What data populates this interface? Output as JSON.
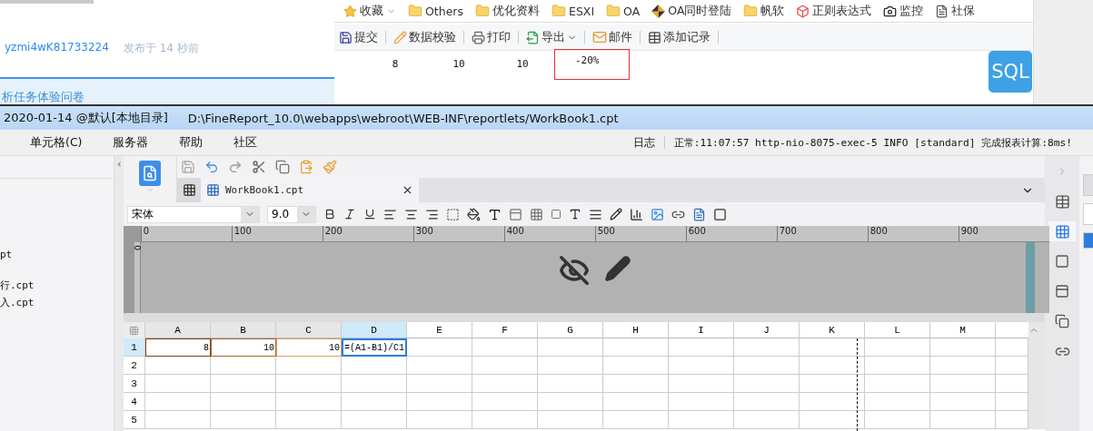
{
  "web_page": {
    "author": "yzmi4wK81733224",
    "posted": "发布于 14 秒前",
    "banner": "析任务体验问卷"
  },
  "browser": {
    "bookmarks": [
      {
        "label": "收藏",
        "kind": "star"
      },
      {
        "label": "Others",
        "kind": "folder"
      },
      {
        "label": "优化资料",
        "kind": "folder"
      },
      {
        "label": "ESXI",
        "kind": "folder"
      },
      {
        "label": "OA",
        "kind": "folder"
      },
      {
        "label": "OA同时登陆",
        "kind": "pinwheel"
      },
      {
        "label": "帆软",
        "kind": "folder"
      },
      {
        "label": "正则表达式",
        "kind": "cube"
      },
      {
        "label": "监控",
        "kind": "camera"
      },
      {
        "label": "社保",
        "kind": "document"
      }
    ],
    "toolbar": [
      {
        "label": "提交",
        "kind": "save"
      },
      {
        "label": "数据校验",
        "kind": "check"
      },
      {
        "label": "打印",
        "kind": "print"
      },
      {
        "label": "导出",
        "kind": "export"
      },
      {
        "label": "邮件",
        "kind": "mail"
      },
      {
        "label": "添加记录",
        "kind": "add"
      }
    ],
    "report_row": [
      {
        "value": "8",
        "highlighted": false
      },
      {
        "value": "10",
        "highlighted": false
      },
      {
        "value": "10",
        "highlighted": false
      },
      {
        "value": "-20%",
        "highlighted": true
      }
    ],
    "sql_badge": "SQL"
  },
  "designer": {
    "title": {
      "session": "2020-01-14 @默认[本地目录]",
      "path": "D:\\FineReport_10.0\\webapps\\webroot\\WEB-INF\\reportlets/WorkBook1.cpt"
    },
    "menu": [
      "单元格(C)",
      "服务器",
      "帮助",
      "社区"
    ],
    "log_label": "日志",
    "status": "正常:11:07:57 http-nio-8075-exec-5 INFO [standard] 完成报表计算:8ms!",
    "files": [
      "pt",
      "行.cpt",
      "入.cpt"
    ],
    "tab": {
      "label": "WorkBook1.cpt"
    },
    "font": {
      "family": "宋体",
      "size": "9.0"
    },
    "ruler": [
      "0",
      "100",
      "200",
      "300",
      "400",
      "500",
      "600",
      "700",
      "800",
      "900"
    ],
    "vertical_ruler": "0",
    "sheet": {
      "columns": [
        {
          "label": "A",
          "selected": false,
          "referenced": true
        },
        {
          "label": "B",
          "selected": false,
          "referenced": true
        },
        {
          "label": "C",
          "selected": false,
          "referenced": true
        },
        {
          "label": "D",
          "selected": true,
          "referenced": false
        },
        {
          "label": "E",
          "selected": false,
          "referenced": false
        },
        {
          "label": "F",
          "selected": false,
          "referenced": false
        },
        {
          "label": "G",
          "selected": false,
          "referenced": false
        },
        {
          "label": "H",
          "selected": false,
          "referenced": false
        },
        {
          "label": "I",
          "selected": false,
          "referenced": false
        },
        {
          "label": "J",
          "selected": false,
          "referenced": false
        },
        {
          "label": "K",
          "selected": false,
          "referenced": false
        },
        {
          "label": "L",
          "selected": false,
          "referenced": false
        },
        {
          "label": "M",
          "selected": false,
          "referenced": false
        }
      ],
      "rows": [
        {
          "header": "1",
          "selected": true,
          "cells": [
            {
              "value": "8",
              "color": "#7a4517",
              "selected": false
            },
            {
              "value": "10",
              "color": "#a8672c",
              "selected": false
            },
            {
              "value": "10",
              "color": "#d6a262",
              "selected": false
            },
            {
              "value": "=(A1-B1)/C1",
              "color": "#2a7de1",
              "selected": true
            }
          ]
        },
        {
          "header": "2",
          "selected": false,
          "cells": []
        },
        {
          "header": "3",
          "selected": false,
          "cells": []
        },
        {
          "header": "4",
          "selected": false,
          "cells": []
        },
        {
          "header": "5",
          "selected": false,
          "cells": []
        }
      ]
    }
  }
}
